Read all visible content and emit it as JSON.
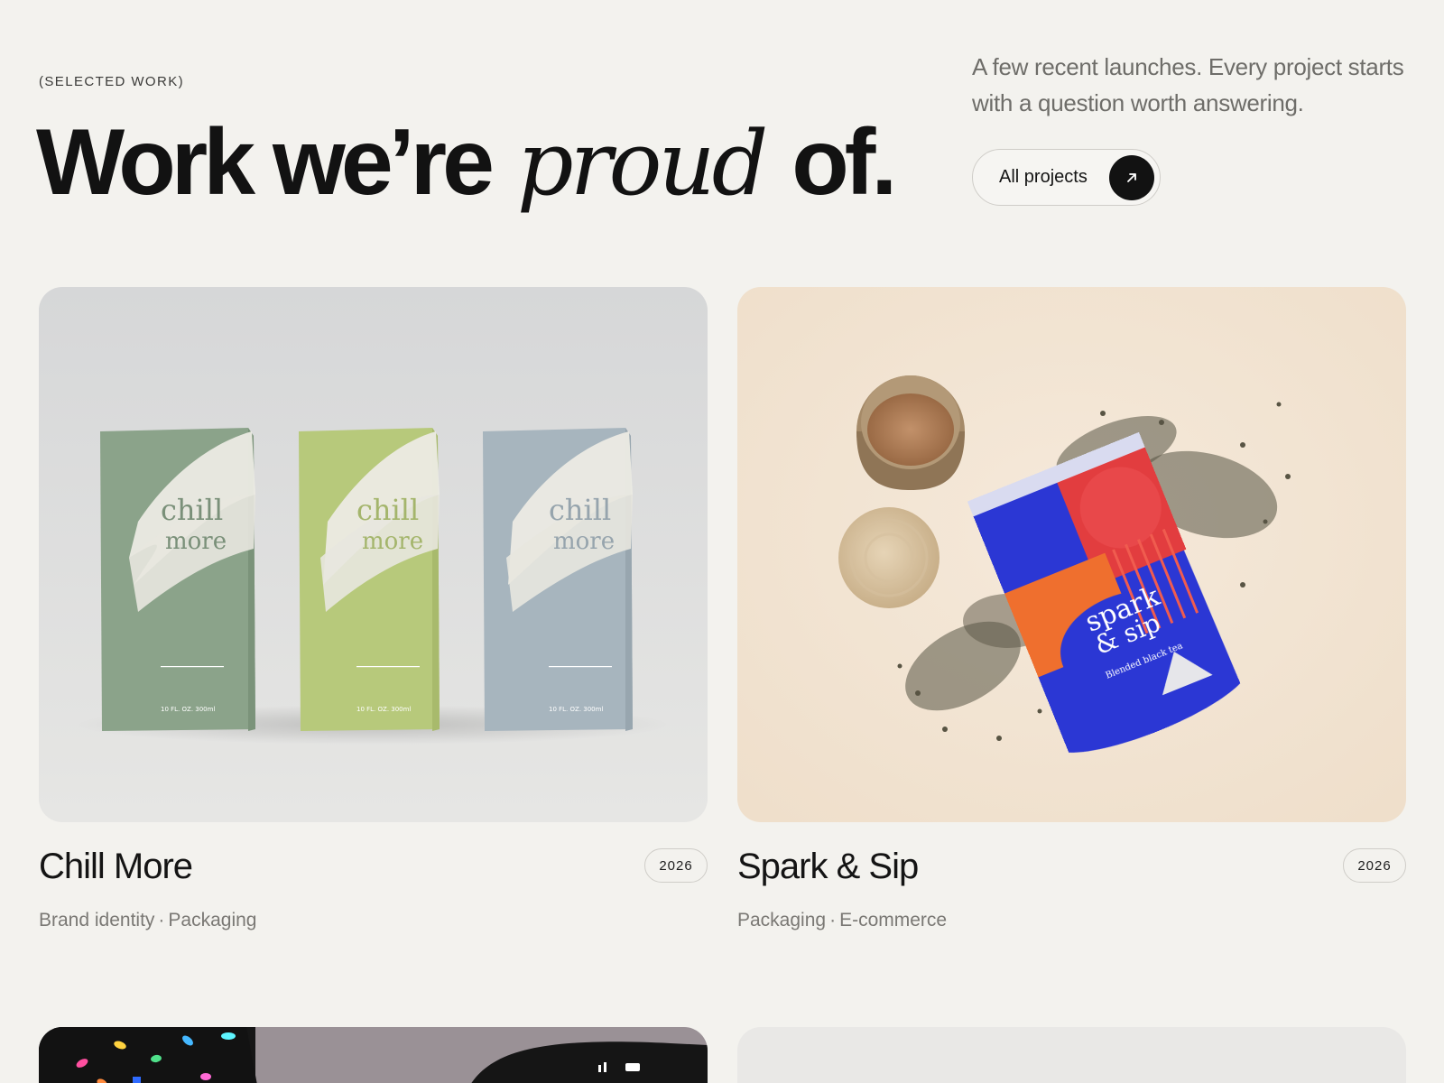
{
  "header": {
    "eyebrow": "(SELECTED WORK)",
    "headline_part1": "Work we’re",
    "headline_emphasis": "proud",
    "headline_part2": "of.",
    "intro": "A few recent launches. Every project starts with a question worth answering.",
    "cta_label": "All projects",
    "cta_icon": "arrow-up-right-icon"
  },
  "projects": [
    {
      "title": "Chill More",
      "year": "2026",
      "tags": [
        "Brand identity",
        "Packaging"
      ],
      "tag_separator": "·",
      "image": "three-shower-gel-boxes",
      "box_text_line1": "chill",
      "box_text_line2": "more",
      "box_fine_print": "10 FL. OZ. 300ml",
      "colors": {
        "background": "#dcdcda",
        "box_green": "#8aa48a",
        "box_lime": "#b8c97a",
        "box_blue": "#a8b6bf"
      }
    },
    {
      "title": "Spark & Sip",
      "year": "2026",
      "tags": [
        "Packaging",
        "E-commerce"
      ],
      "tag_separator": "·",
      "image": "tea-pouch-with-cup",
      "pouch_text_line1": "spark",
      "pouch_text_line2": "& sip",
      "pouch_subtext": "Blended black tea",
      "colors": {
        "background": "#f2e4d3",
        "pouch_blue": "#2a36d6",
        "pouch_red": "#e63a3a",
        "pouch_orange": "#f0722e"
      }
    },
    {
      "image": "phone-with-confetti",
      "colors": {
        "background": "#9a9196"
      }
    },
    {
      "image": "light-textured-surface",
      "colors": {
        "background": "#e9e8e6"
      }
    }
  ],
  "colors": {
    "page_background": "#f3f2ee",
    "ink": "#141414",
    "muted": "#6e6d69"
  }
}
